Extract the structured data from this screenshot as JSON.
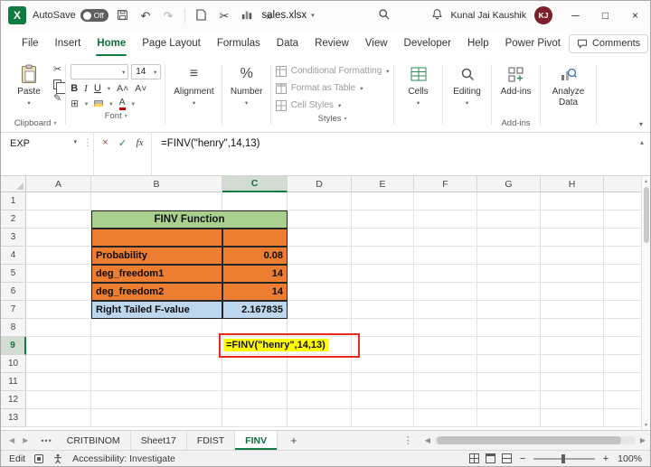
{
  "title_bar": {
    "autosave_label": "AutoSave",
    "autosave_state": "Off",
    "filename": "sales.xlsx",
    "user_name": "Kunal Jai Kaushik",
    "user_initials": "KJ"
  },
  "menu_bar": {
    "tabs": [
      "File",
      "Insert",
      "Home",
      "Page Layout",
      "Formulas",
      "Data",
      "Review",
      "View",
      "Developer",
      "Help",
      "Power Pivot"
    ],
    "active_tab": "Home",
    "comments_label": "Comments"
  },
  "ribbon": {
    "paste_label": "Paste",
    "clipboard_group": "Clipboard",
    "font_group": "Font",
    "font_size": "14",
    "bold": "B",
    "italic": "I",
    "underline": "U",
    "alignment_label": "Alignment",
    "number_label": "Number",
    "conditional_formatting": "Conditional Formatting",
    "format_as_table": "Format as Table",
    "cell_styles": "Cell Styles",
    "styles_group": "Styles",
    "cells_label": "Cells",
    "editing_label": "Editing",
    "addins_label": "Add-ins",
    "addins_group": "Add-ins",
    "analyze_data_label": "Analyze Data"
  },
  "formula_bar": {
    "name_box": "EXP",
    "fx_label": "fx",
    "formula": "=FINV(\"henry\",14,13)"
  },
  "grid": {
    "columns": [
      "A",
      "B",
      "C",
      "D",
      "E",
      "F",
      "G",
      "H"
    ],
    "rows": [
      "1",
      "2",
      "3",
      "4",
      "5",
      "6",
      "7",
      "8",
      "9",
      "10",
      "11",
      "12",
      "13"
    ],
    "active_column": "C",
    "active_row": "9"
  },
  "worksheet": {
    "table_title": "FINV Function",
    "rows": [
      {
        "label": "Probability",
        "value": "0.08"
      },
      {
        "label": "deg_freedom1",
        "value": "14"
      },
      {
        "label": "deg_freedom2",
        "value": "14"
      },
      {
        "label": "Right Tailed F-value",
        "value": "2.167835"
      }
    ],
    "edit_cell_formula": "=FINV(\"henry\",14,13)"
  },
  "sheet_tabs": {
    "overflow": "•••",
    "tabs": [
      "CRITBINOM",
      "Sheet17",
      "FDIST",
      "FINV"
    ],
    "active_tab": "FINV",
    "add_sheet": "+"
  },
  "status_bar": {
    "mode": "Edit",
    "accessibility": "Accessibility: Investigate",
    "zoom_level": "100%"
  },
  "icons": {
    "dropdown": "▾",
    "collapse": "▴",
    "undo": "↶",
    "redo": "↷",
    "cut": "✂",
    "format_painter": "✎",
    "overflow": "»",
    "minimize": "─",
    "maximize": "□",
    "close": "×",
    "cancel": "×",
    "check": "✓",
    "borders": "⊞",
    "alignment_lines": "≡",
    "percent": "%",
    "dots": "•••",
    "dots_vertical": "⋮",
    "left": "◀",
    "right": "▶",
    "plus": "+",
    "minus": "−",
    "share_arrow": "↗"
  },
  "colors": {
    "excel_green": "#107c41",
    "table_header_green": "#a9d08e",
    "table_orange": "#ed7d31",
    "table_blue": "#bdd7ee",
    "formula_highlight": "#ffff00",
    "annotation_red": "#e8291c",
    "avatar_maroon": "#7e1f2e"
  }
}
